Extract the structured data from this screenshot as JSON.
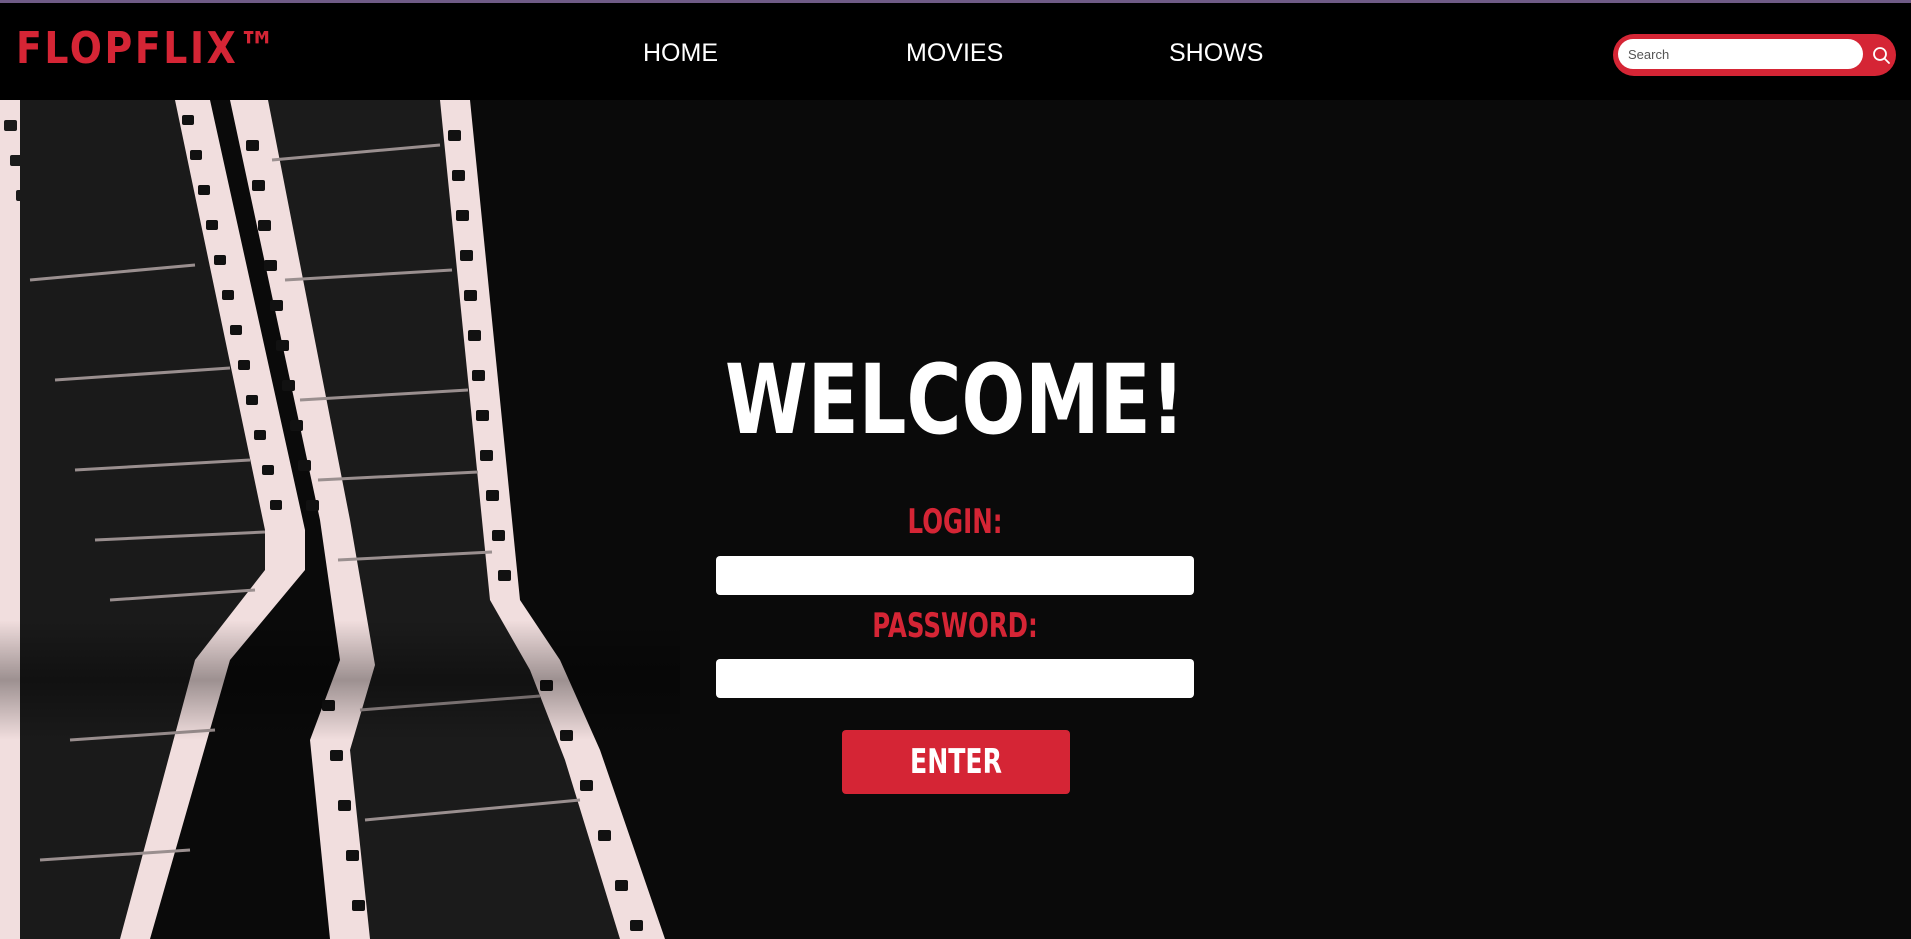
{
  "brand": {
    "logo_text": "FLOPFLIX™"
  },
  "nav": {
    "items": [
      {
        "label": "HOME"
      },
      {
        "label": "MOVIES"
      },
      {
        "label": "SHOWS"
      }
    ]
  },
  "search": {
    "placeholder": "Search",
    "value": "",
    "icon": "search-icon"
  },
  "hero": {
    "image": "film-strip-illustration"
  },
  "login_form": {
    "title": "WELCOME!",
    "login_label": "LOGIN:",
    "login_value": "",
    "password_label": "PASSWORD:",
    "password_value": "",
    "submit_label": "ENTER"
  },
  "colors": {
    "accent": "#d52535",
    "background": "#0a0a0a",
    "navbar": "#000000",
    "top_border": "#6f5b86",
    "text": "#ffffff"
  }
}
